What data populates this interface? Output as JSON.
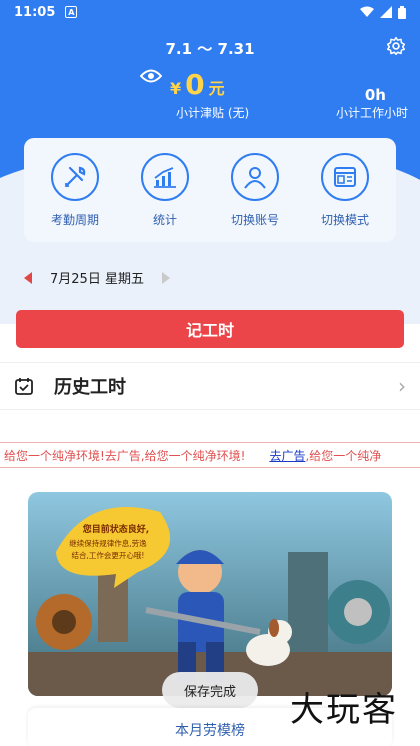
{
  "status_bar": {
    "time": "11:05",
    "notification_icon": "A"
  },
  "header": {
    "date_range": "7.1 ～ 7.31",
    "money_symbol": "¥",
    "money_value": "0",
    "money_unit": "元",
    "allowance_label": "小计津贴 (无)",
    "hours_value": "0h",
    "hours_label": "小计工作小时"
  },
  "tools": [
    {
      "label": "考勤周期",
      "icon": "tools-icon"
    },
    {
      "label": "统计",
      "icon": "bar-chart-icon"
    },
    {
      "label": "切换账号",
      "icon": "user-icon"
    },
    {
      "label": "切换模式",
      "icon": "layout-icon"
    }
  ],
  "date_selector": {
    "date": "7月25日 星期五"
  },
  "record_button": "记工时",
  "history": {
    "label": "历史工时"
  },
  "ad_banner": {
    "text": "给您一个纯净环境!去广告,给您一个纯净环境!",
    "link": "去广告",
    "text_after": ",给您一个纯净"
  },
  "illustration": {
    "speech": "您目前状态良好，继续保持规律作息，劳逸结合，工作会更开心哦！"
  },
  "toast": "保存完成",
  "bottom_card": "本月劳模榜",
  "watermark": "大玩客",
  "colors": {
    "primary": "#2f7df0",
    "accent_red": "#ec4549",
    "money": "#ffd34a"
  }
}
